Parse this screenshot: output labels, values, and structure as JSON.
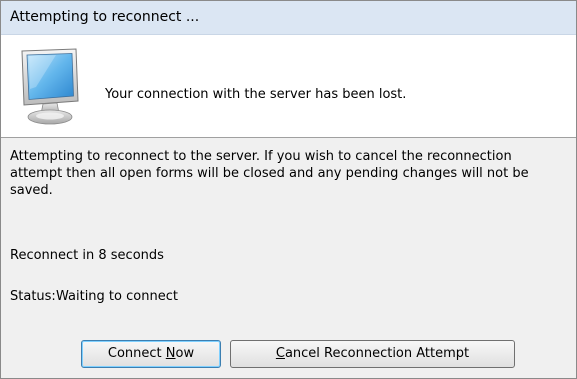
{
  "window": {
    "title": "Attempting to reconnect ..."
  },
  "header": {
    "icon": "monitor-icon",
    "message": "Your connection with the server has been lost."
  },
  "body": {
    "description": "Attempting to reconnect to the server.  If you wish to cancel the reconnection attempt then all open forms will be closed and any pending changes will not be saved.",
    "reconnect_countdown": "Reconnect in 8 seconds",
    "status_label": "Status:",
    "status_value": "Waiting to connect"
  },
  "buttons": {
    "connect_now": {
      "before": "Connect ",
      "accel": "N",
      "after": "ow"
    },
    "cancel": {
      "before": "",
      "accel": "C",
      "after": "ancel Reconnection Attempt"
    }
  },
  "colors": {
    "titlebar": "#dbe6f3",
    "dialog_background": "#f0f0f0",
    "header_background": "#ffffff",
    "default_button_border": "#3c7fb1"
  }
}
